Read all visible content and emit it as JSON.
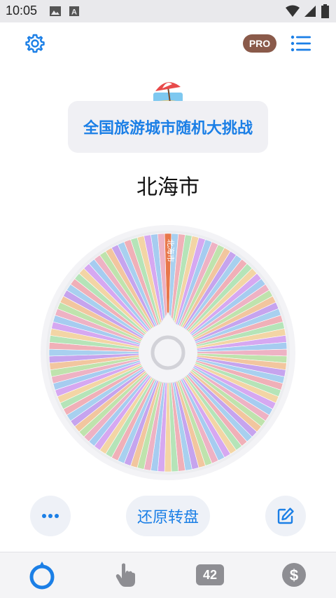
{
  "status_bar": {
    "time": "10:05",
    "icons": [
      "image-icon",
      "a-box-icon",
      "wifi-icon",
      "signal-icon",
      "battery-icon"
    ]
  },
  "topbar": {
    "settings_icon": "gear-icon",
    "pro_label": "PRO",
    "menu_icon": "list-icon"
  },
  "wheel_title": {
    "emoji": "beach-umbrella-icon",
    "text": "全国旅游城市随机大挑战"
  },
  "result": "北海市",
  "wheel": {
    "selected_label": "北海市",
    "palette": [
      "#c6a4ee",
      "#a8d0ef",
      "#f0b0b8",
      "#b5e4b8",
      "#f3d5a5",
      "#d6a8f1",
      "#a6ccf0",
      "#eeb2c4",
      "#bfe3ad",
      "#f2c69f"
    ],
    "selected_color": "#e8774a"
  },
  "bottom_actions": {
    "more_icon": "more-dots-icon",
    "reset_label": "还原转盘",
    "edit_icon": "edit-icon"
  },
  "bottom_nav": {
    "wheel_icon": "wheel-icon",
    "tap_icon": "hand-pointer-icon",
    "count": "42",
    "dollar_icon": "dollar-icon"
  },
  "colors": {
    "accent": "#1b7fe6",
    "pro_badge": "#8a5a4a"
  }
}
